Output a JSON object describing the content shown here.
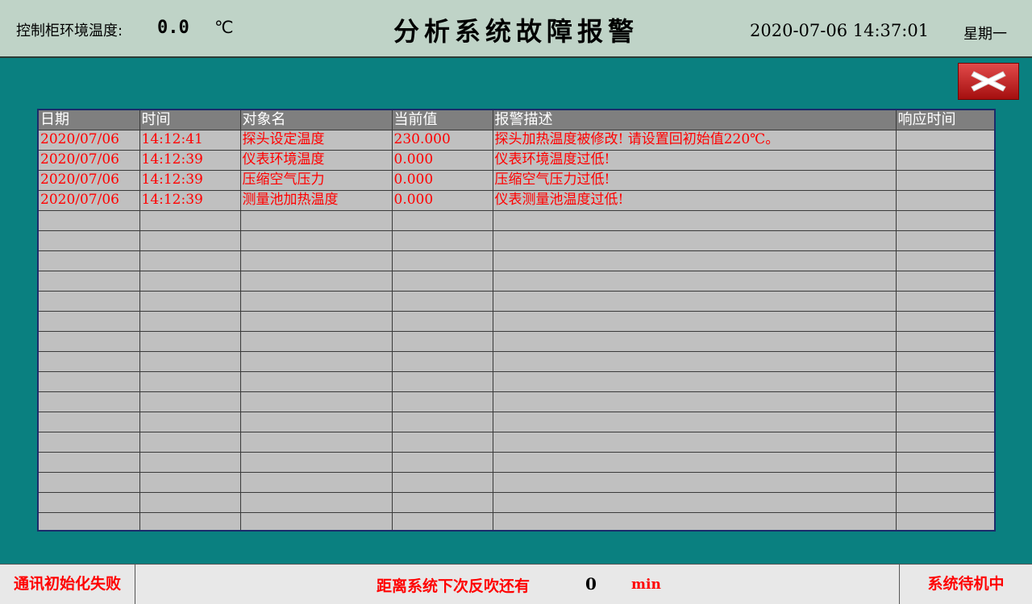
{
  "header": {
    "env_label": "控制柜环境温度:",
    "env_value": "0.0",
    "env_unit": "℃",
    "title": "分析系统故障报警",
    "datetime": "2020-07-06 14:37:01",
    "weekday": "星期一"
  },
  "close_button": {
    "icon": "close-x-icon",
    "color": "#c8201f"
  },
  "table": {
    "columns": [
      "日期",
      "时间",
      "对象名",
      "当前值",
      "报警描述",
      "响应时间"
    ],
    "rows": [
      [
        "2020/07/06",
        "14:12:41",
        "探头设定温度",
        "230.000",
        "探头加热温度被修改! 请设置回初始值220℃。",
        ""
      ],
      [
        "2020/07/06",
        "14:12:39",
        "仪表环境温度",
        "0.000",
        "仪表环境温度过低!",
        ""
      ],
      [
        "2020/07/06",
        "14:12:39",
        "压缩空气压力",
        "0.000",
        "压缩空气压力过低!",
        ""
      ],
      [
        "2020/07/06",
        "14:12:39",
        "测量池加热温度",
        "0.000",
        "仪表测量池温度过低!",
        ""
      ]
    ],
    "alarm_color": "#ff0000"
  },
  "footer": {
    "comm_status": "通讯初始化失败",
    "countdown_label": "距离系统下次反吹还有",
    "countdown_value": "0",
    "countdown_unit": "min",
    "system_status": "系统待机中"
  }
}
